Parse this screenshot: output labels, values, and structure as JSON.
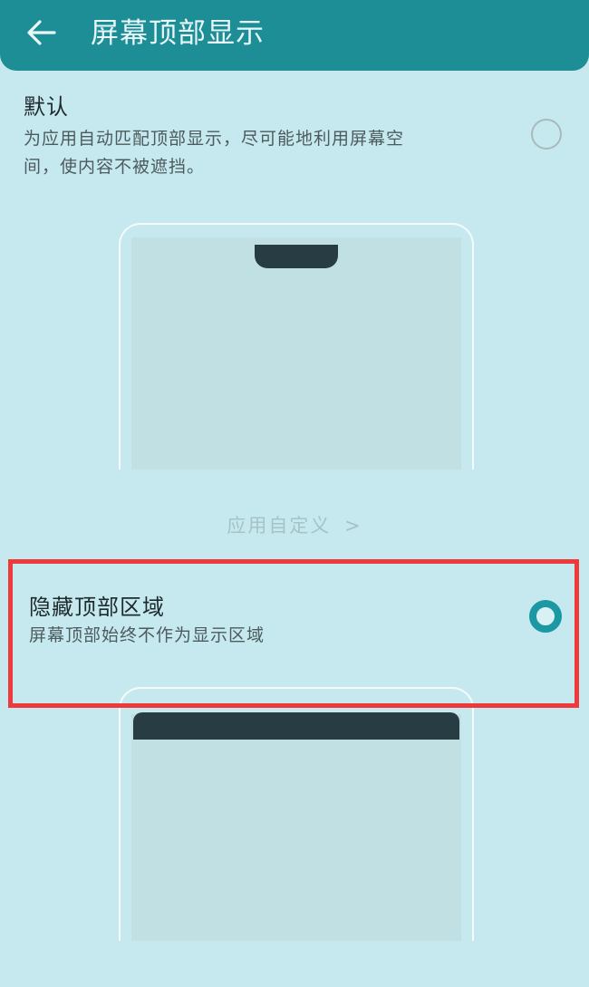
{
  "header": {
    "title": "屏幕顶部显示",
    "back_icon": "back-arrow-icon"
  },
  "options": [
    {
      "title": "默认",
      "description_line1": "为应用自动匹配顶部显示，尽可能地利用屏幕空",
      "description_line2": "间，使内容不被遮挡。",
      "selected": false
    },
    {
      "title": "隐藏顶部区域",
      "description": "屏幕顶部始终不作为显示区域",
      "selected": true
    }
  ],
  "custom_link": {
    "label": "应用自定义",
    "chevron": ">"
  },
  "colors": {
    "header_bg": "#1e8e96",
    "page_bg": "#c5e9ef",
    "accent": "#1a99a2",
    "highlight": "#ee3a3a"
  }
}
